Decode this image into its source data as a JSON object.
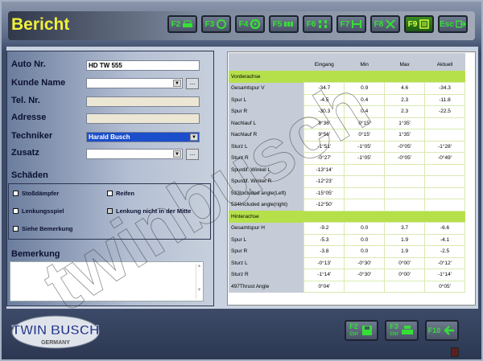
{
  "title": "Bericht",
  "toolbar": [
    {
      "key": "F2",
      "icon": "car-icon"
    },
    {
      "key": "F3",
      "icon": "wheel-icon"
    },
    {
      "key": "F4",
      "icon": "target-icon"
    },
    {
      "key": "F5",
      "icon": "tires-icon"
    },
    {
      "key": "F6",
      "icon": "axle-icon"
    },
    {
      "key": "F7",
      "icon": "alignment-icon"
    },
    {
      "key": "F8",
      "icon": "adjust-icon"
    },
    {
      "key": "F9",
      "icon": "report-icon",
      "active": true
    },
    {
      "key": "Esc",
      "icon": "exit-icon"
    }
  ],
  "form": {
    "auto_nr_label": "Auto Nr.",
    "auto_nr": "HD TW 555",
    "kunde_label": "Kunde Name",
    "kunde": "",
    "tel_label": "Tel. Nr.",
    "tel": "",
    "adresse_label": "Adresse",
    "adresse": "",
    "techniker_label": "Techniker",
    "techniker": "Harald Busch",
    "zusatz_label": "Zusatz",
    "zusatz": "",
    "more": "...",
    "schaeden_label": "Schäden",
    "damages": [
      {
        "label": "Stoßdämpfer",
        "checked": false
      },
      {
        "label": "Reifen",
        "checked": false
      },
      {
        "label": "Lenkungsspiel",
        "checked": false
      },
      {
        "label": "Lenkung nicht in der Mitte",
        "checked": true
      },
      {
        "label": "Siehe Bemerkung",
        "checked": false
      }
    ],
    "bemerkung_label": "Bemerkung",
    "bemerkung": ""
  },
  "table": {
    "headers": [
      "",
      "Eingang",
      "Min",
      "Max",
      "Aktuell"
    ],
    "sections": [
      {
        "name": "Vorderachse",
        "rows": [
          [
            "Gesamtspur V",
            "-34.7",
            "0.9",
            "4.6",
            "-34.3"
          ],
          [
            "Spur L",
            "-4.5",
            "0.4",
            "2.3",
            "-11.8"
          ],
          [
            "Spur R",
            "-30.3",
            "0.4",
            "2.3",
            "-22.5"
          ],
          [
            "Nachlauf L",
            "8°36'",
            "0°15'",
            "1°35'",
            ""
          ],
          [
            "Nachlauf R",
            "9°56'",
            "0°15'",
            "1°35'",
            ""
          ],
          [
            "Sturz L",
            "-1°51'",
            "-1°05'",
            "-0°05'",
            "-1°28'"
          ],
          [
            "Sturz R",
            "-0°27'",
            "-1°05'",
            "-0°05'",
            "-0°49'"
          ],
          [
            "Spurdif. Winkel L",
            "-13°14'",
            "",
            "",
            ""
          ],
          [
            "Spurdif. Winkel R",
            "-12°23'",
            "",
            "",
            ""
          ],
          [
            "533Included angle(Left)",
            "-15°05'",
            "",
            "",
            ""
          ],
          [
            "534Included angle(right)",
            "-12°50'",
            "",
            "",
            ""
          ]
        ]
      },
      {
        "name": "Hinterachse",
        "rows": [
          [
            "Gesamtspur H",
            "-9.2",
            "0.0",
            "3.7",
            "-6.6"
          ],
          [
            "Spur L",
            "-5.3",
            "0.0",
            "1.9",
            "-4.1"
          ],
          [
            "Spur R",
            "-3.8",
            "0.0",
            "1.9",
            "-2.5"
          ],
          [
            "Sturz L",
            "-0°13'",
            "-0°30'",
            "0°00'",
            "-0°12'"
          ],
          [
            "Sturz R",
            "-1°14'",
            "-0°30'",
            "0°00'",
            "-1°14'"
          ],
          [
            "497Thrust Angle",
            "0°04'",
            "",
            "",
            "0°05'"
          ]
        ]
      }
    ]
  },
  "bottom": [
    {
      "key": "F2",
      "sub": "Ctrl",
      "icon": "save-icon"
    },
    {
      "key": "F3",
      "sub": "Ctrl",
      "icon": "print-icon"
    },
    {
      "key": "F10",
      "sub": "",
      "icon": "back-arrow-icon"
    }
  ],
  "logo": {
    "text": "TWIN BUSCH",
    "sub": "GERMANY"
  },
  "watermark": "twinbusch",
  "colors": {
    "accent": "#35e035",
    "title": "#f2ef3a",
    "section": "#b6e04a",
    "selected": "#1b4ecb"
  }
}
